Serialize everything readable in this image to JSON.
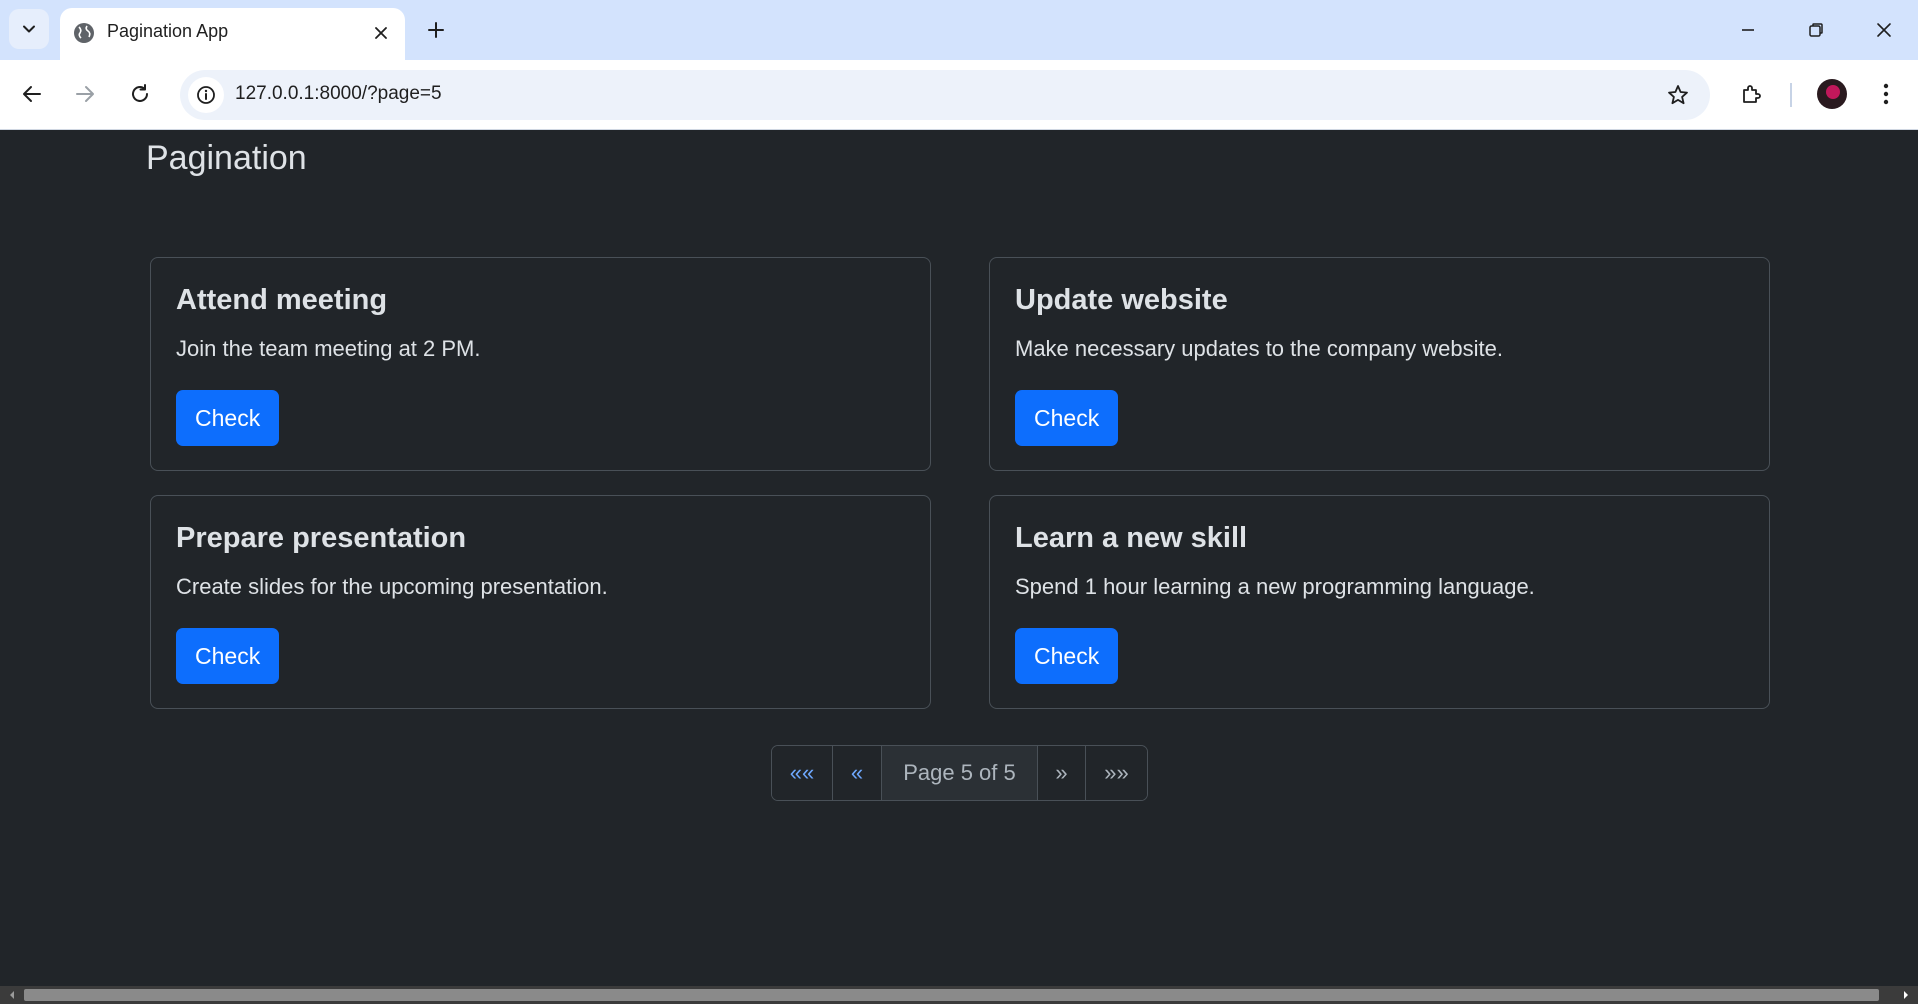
{
  "browser": {
    "tab_title": "Pagination App",
    "url": "127.0.0.1:8000/?page=5"
  },
  "page": {
    "heading": "Pagination",
    "cards": [
      {
        "title": "Attend meeting",
        "text": "Join the team meeting at 2 PM.",
        "button": "Check"
      },
      {
        "title": "Update website",
        "text": "Make necessary updates to the company website.",
        "button": "Check"
      },
      {
        "title": "Prepare presentation",
        "text": "Create slides for the upcoming presentation.",
        "button": "Check"
      },
      {
        "title": "Learn a new skill",
        "text": "Spend 1 hour learning a new programming language.",
        "button": "Check"
      }
    ],
    "pagination": {
      "first": "««",
      "prev": "«",
      "current": "Page 5 of 5",
      "next": "»",
      "last": "»»"
    }
  },
  "colors": {
    "page_background": "#212529",
    "button_primary": "#0d6efd",
    "link": "#6ea8fe"
  }
}
